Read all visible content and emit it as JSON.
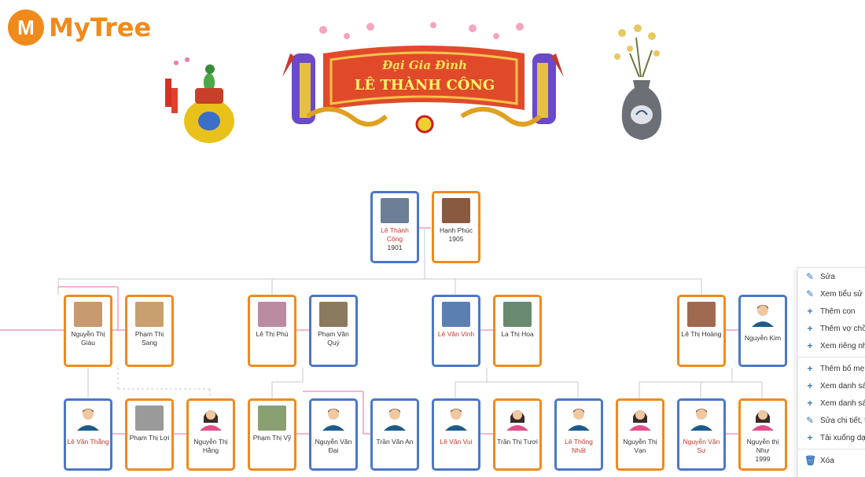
{
  "logo": {
    "mark": "M",
    "name": "MyTree"
  },
  "banner": {
    "line1": "Đại Gia Đình",
    "line2": "LÊ THÀNH CÔNG"
  },
  "tree": {
    "gen1": [
      {
        "name": "Lê Thành Công",
        "year": "1901",
        "gender": "male",
        "red": true,
        "photo": "#6d7f96"
      },
      {
        "name": "Hạnh Phúc",
        "year": "1905",
        "gender": "female",
        "red": false,
        "photo": "#8a5a40"
      }
    ],
    "gen2": [
      {
        "name": "Nguyễn Thị Giàu",
        "gender": "female",
        "red": false,
        "photo": "#c89a70"
      },
      {
        "name": "Phạm Thị Sang",
        "gender": "female",
        "red": false,
        "photo": "#c8a070"
      },
      {
        "name": "Lê Thị Phú",
        "gender": "female",
        "red": false,
        "photo": "#b98aa0"
      },
      {
        "name": "Phạm Văn Quý",
        "gender": "male",
        "red": false,
        "photo": "#8a7a60"
      },
      {
        "name": "Lê Văn Vinh",
        "gender": "male",
        "red": true,
        "photo": "#5a7fb0"
      },
      {
        "name": "La Thị Hoa",
        "gender": "female",
        "red": false,
        "photo": "#6a8a70"
      },
      {
        "name": "Lê Thị Hoàng",
        "gender": "female",
        "red": false,
        "photo": "#a06a50"
      },
      {
        "name": "Nguyễn Kim",
        "gender": "male",
        "red": false,
        "photo": "avatar-male"
      }
    ],
    "gen3": [
      {
        "name": "Lê Văn Thắng",
        "gender": "male",
        "red": true,
        "photo": "avatar-male"
      },
      {
        "name": "Phạm Thị Lợi",
        "gender": "female",
        "red": false,
        "photo": "#9a9a9a"
      },
      {
        "name": "Nguyễn Thị Hằng",
        "gender": "female",
        "red": false,
        "photo": "avatar-female"
      },
      {
        "name": "Phạm Thị Vỹ",
        "gender": "female",
        "red": false,
        "photo": "#8aa070"
      },
      {
        "name": "Nguyễn Văn Đại",
        "gender": "male",
        "red": false,
        "photo": "avatar-male"
      },
      {
        "name": "Trần Văn An",
        "gender": "male",
        "red": false,
        "photo": "avatar-male"
      },
      {
        "name": "Lê Văn Vui",
        "gender": "male",
        "red": true,
        "photo": "avatar-male"
      },
      {
        "name": "Trần Thị Tươi",
        "gender": "female",
        "red": false,
        "photo": "avatar-female"
      },
      {
        "name": "Lê Thống Nhất",
        "gender": "male",
        "red": true,
        "photo": "avatar-male"
      },
      {
        "name": "Nguyễn Thị Vạn",
        "gender": "female",
        "red": false,
        "photo": "avatar-female"
      },
      {
        "name": "Nguyễn Văn Sự",
        "gender": "male",
        "red": true,
        "photo": "avatar-male"
      },
      {
        "name": "Nguyễn thị Như",
        "year": "1999",
        "gender": "female",
        "red": false,
        "photo": "avatar-female"
      }
    ]
  },
  "context_menu": {
    "items": [
      {
        "icon": "edit-icon",
        "label": "Sửa"
      },
      {
        "icon": "edit-icon",
        "label": "Xem tiểu sử"
      },
      {
        "icon": "plus-icon",
        "label": "Thêm con"
      },
      {
        "icon": "plus-icon",
        "label": "Thêm vợ chồ"
      },
      {
        "icon": "plus-icon",
        "label": "Xem riêng nh"
      },
      {
        "icon": "plus-icon",
        "label": "Thêm bố mẹ"
      },
      {
        "icon": "plus-icon",
        "label": "Xem danh sá"
      },
      {
        "icon": "plus-icon",
        "label": "Xem danh sá"
      },
      {
        "icon": "edit-icon",
        "label": "Sửa chi tiết, t"
      },
      {
        "icon": "plus-icon",
        "label": "Tải xuống dạ"
      },
      {
        "icon": "trash-icon",
        "label": "Xóa"
      }
    ]
  },
  "colors": {
    "brand": "#f08a1c",
    "male_border": "#4a77c9",
    "female_border": "#f08a1c",
    "name_red": "#c0392b",
    "link_pink": "#e86aa8"
  }
}
